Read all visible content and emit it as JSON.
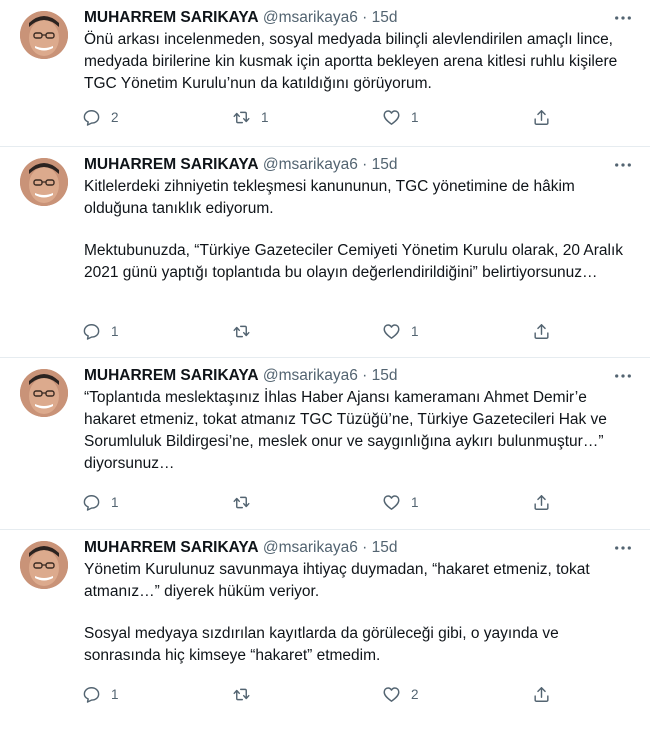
{
  "tweets": [
    {
      "author": {
        "name": "MUHARREM SARIKAYA",
        "handle": "@msarikaya6",
        "time": "15d"
      },
      "paragraphs": [
        "Önü arkası incelenmeden, sosyal medyada bilinçli alevlendirilen amaçlı lince, medyada birilerine kin kusmak için aportta bekleyen arena kitlesi ruhlu kişilere TGC Yönetim Kurulu’nun da katıldığını görüyorum."
      ],
      "stats": {
        "replies": "2",
        "retweets": "1",
        "likes": "1"
      }
    },
    {
      "author": {
        "name": "MUHARREM SARIKAYA",
        "handle": "@msarikaya6",
        "time": "15d"
      },
      "paragraphs": [
        "Kitlelerdeki zihniyetin tekleşmesi kanununun, TGC yönetimine de hâkim olduğuna tanıklık ediyorum.",
        "Mektubunuzda, “Türkiye Gazeteciler Cemiyeti Yönetim Kurulu olarak, 20 Aralık 2021 günü yaptığı toplantıda bu olayın değerlendirildiğini” belirtiyorsunuz…"
      ],
      "stats": {
        "replies": "1",
        "retweets": "",
        "likes": "1"
      }
    },
    {
      "author": {
        "name": "MUHARREM SARIKAYA",
        "handle": "@msarikaya6",
        "time": "15d"
      },
      "paragraphs": [
        "“Toplantıda meslektaşınız İhlas Haber Ajansı kameramanı Ahmet Demir’e hakaret etmeniz, tokat atmanız TGC Tüzüğü’ne, Türkiye Gazetecileri Hak ve Sorumluluk Bildirgesi’ne, meslek onur ve saygınlığına aykırı bulunmuştur…” diyorsunuz…"
      ],
      "stats": {
        "replies": "1",
        "retweets": "",
        "likes": "1"
      }
    },
    {
      "author": {
        "name": "MUHARREM SARIKAYA",
        "handle": "@msarikaya6",
        "time": "15d"
      },
      "paragraphs": [
        "Yönetim Kurulunuz savunmaya ihtiyaç duymadan, “hakaret etmeniz, tokat atmanız…” diyerek hüküm veriyor.",
        "Sosyal medyaya sızdırılan kayıtlarda da görüleceği gibi, o yayında ve sonrasında hiç kimseye “hakaret” etmedim."
      ],
      "stats": {
        "replies": "1",
        "retweets": "",
        "likes": "2"
      }
    }
  ],
  "separator": "·",
  "icons": {
    "avatar": "avatar",
    "more": "more-dots-icon",
    "reply": "reply-icon",
    "retweet": "retweet-icon",
    "like": "like-heart-icon",
    "share": "share-icon"
  },
  "colors": {
    "text": "#0f1419",
    "secondary": "#536471",
    "divider": "#e6ecf0",
    "background": "#ffffff"
  }
}
